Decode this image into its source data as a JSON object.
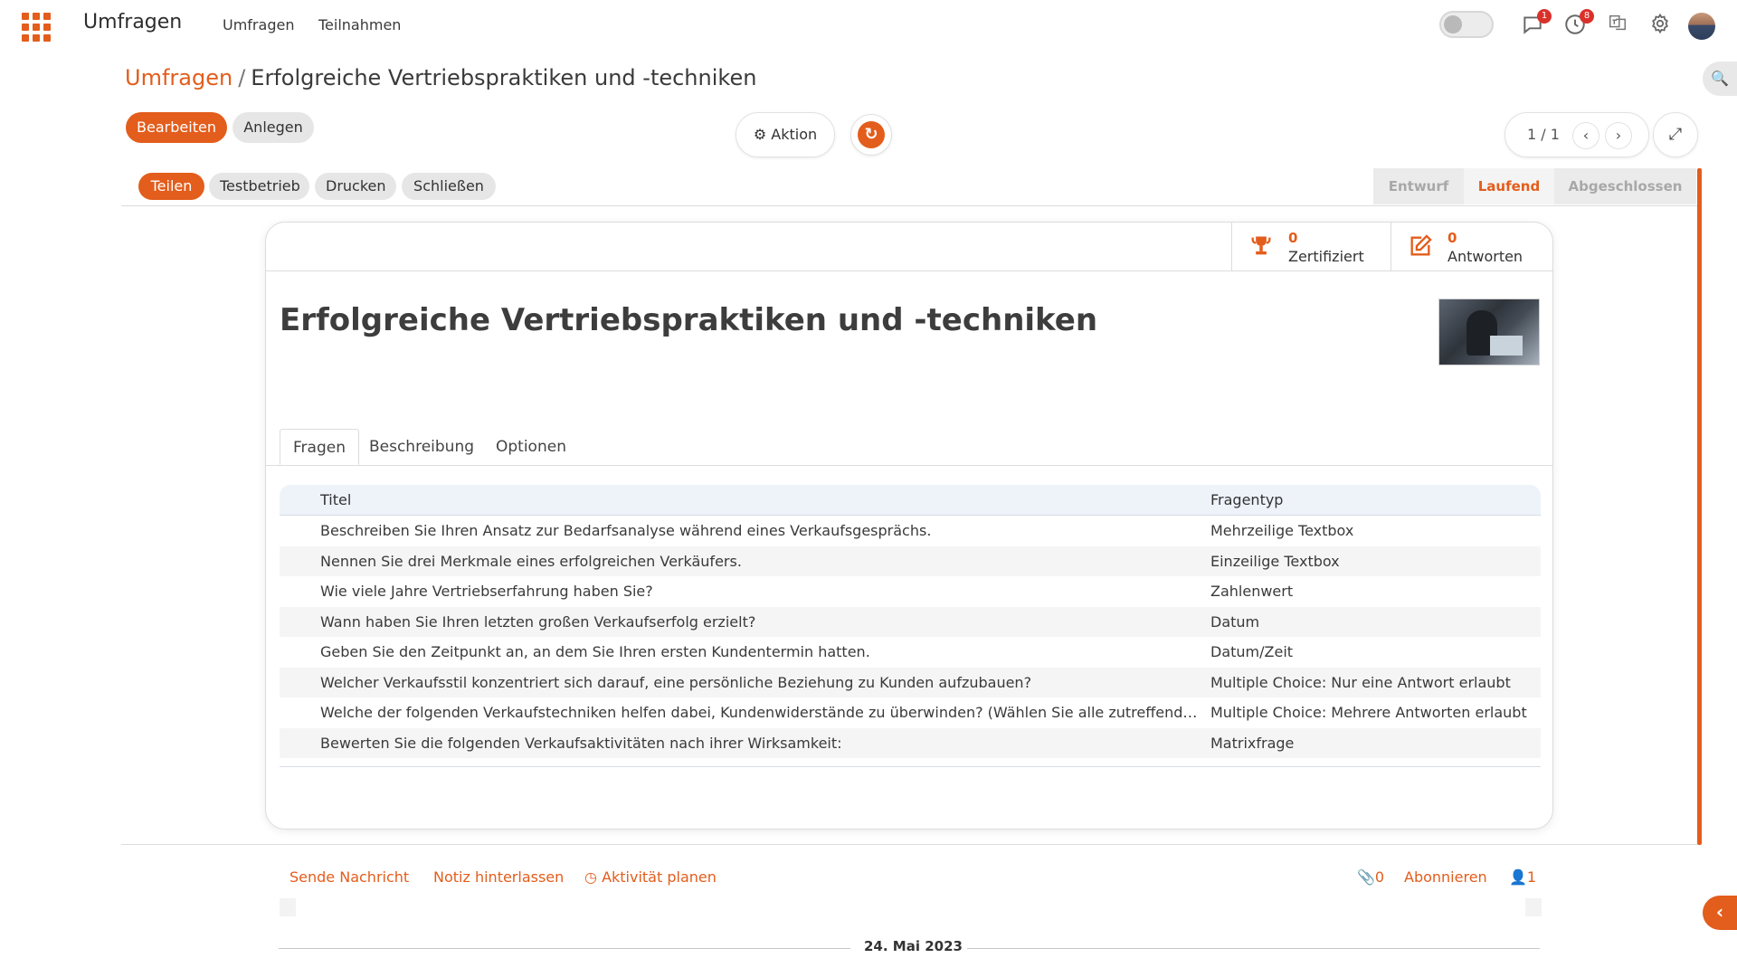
{
  "navbar": {
    "brand": "Umfragen",
    "menu": [
      "Umfragen",
      "Teilnahmen"
    ],
    "messages_count": "1",
    "activities_count": "8"
  },
  "breadcrumb": {
    "parent": "Umfragen",
    "separator": "/",
    "current": "Erfolgreiche Vertriebspraktiken und -techniken"
  },
  "control": {
    "edit_label": "Bearbeiten",
    "create_label": "Anlegen",
    "action_label": "Aktion",
    "pager": "1 / 1"
  },
  "statusbar": {
    "buttons": [
      "Teilen",
      "Testbetrieb",
      "Drucken",
      "Schließen"
    ],
    "stages": [
      "Entwurf",
      "Laufend",
      "Abgeschlossen"
    ],
    "active_stage": "Laufend"
  },
  "smart_buttons": [
    {
      "value": "0",
      "label": "Zertifiziert",
      "icon": "trophy-icon"
    },
    {
      "value": "0",
      "label": "Antworten",
      "icon": "edit-icon"
    }
  ],
  "survey": {
    "title": "Erfolgreiche Vertriebspraktiken und -techniken",
    "tabs": [
      "Fragen",
      "Beschreibung",
      "Optionen"
    ],
    "active_tab": "Fragen",
    "columns": {
      "title": "Titel",
      "type": "Fragentyp"
    },
    "questions": [
      {
        "title": "Beschreiben Sie Ihren Ansatz zur Bedarfsanalyse während eines Verkaufsgesprächs.",
        "type": "Mehrzeilige Textbox"
      },
      {
        "title": "Nennen Sie drei Merkmale eines erfolgreichen Verkäufers.",
        "type": "Einzeilige Textbox"
      },
      {
        "title": "Wie viele Jahre Vertriebserfahrung haben Sie?",
        "type": "Zahlenwert"
      },
      {
        "title": "Wann haben Sie Ihren letzten großen Verkaufserfolg erzielt?",
        "type": "Datum"
      },
      {
        "title": "Geben Sie den Zeitpunkt an, an dem Sie Ihren ersten Kundentermin hatten.",
        "type": "Datum/Zeit"
      },
      {
        "title": "Welcher Verkaufsstil konzentriert sich darauf, eine persönliche Beziehung zu Kunden aufzubauen?",
        "type": "Multiple Choice: Nur eine Antwort erlaubt"
      },
      {
        "title": "Welche der folgenden Verkaufstechniken helfen dabei, Kundenwiderstände zu überwinden? (Wählen Sie alle zutreffenden aus)",
        "type": "Multiple Choice: Mehrere Antworten erlaubt"
      },
      {
        "title": "Bewerten Sie die folgenden Verkaufsaktivitäten nach ihrer Wirksamkeit:",
        "type": "Matrixfrage"
      }
    ]
  },
  "chatter": {
    "send_message": "Sende Nachricht",
    "log_note": "Notiz hinterlassen",
    "schedule_activity": "Aktivität planen",
    "attachments": "0",
    "follow": "Abonnieren",
    "followers": "1",
    "date": "24. Mai 2023"
  },
  "colors": {
    "accent": "#e35d1c",
    "badge": "#d9312a"
  }
}
